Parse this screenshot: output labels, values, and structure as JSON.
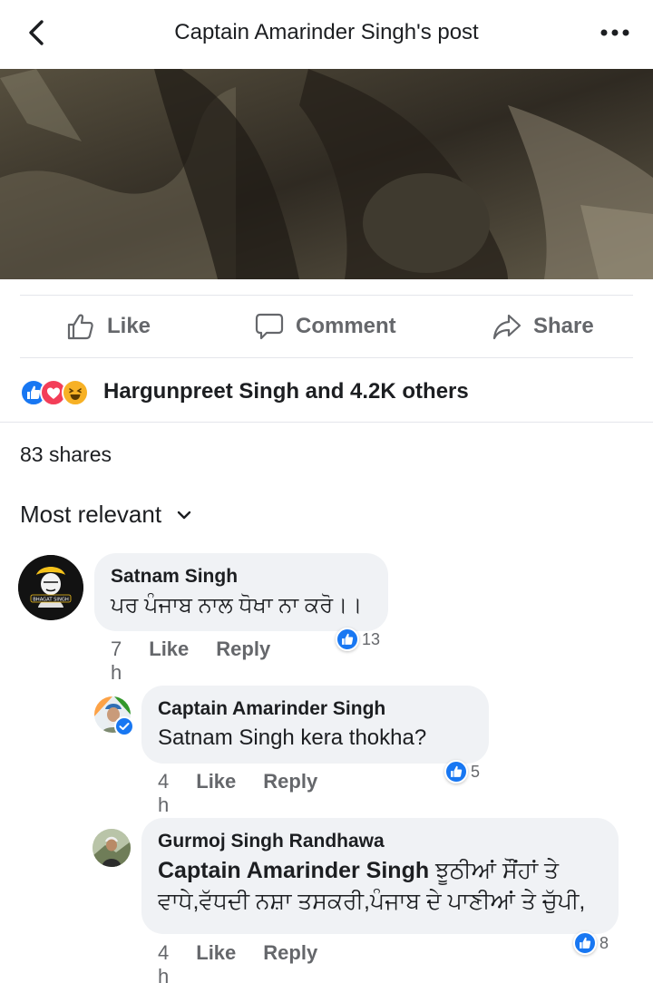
{
  "header": {
    "title": "Captain Amarinder Singh's post"
  },
  "actions": {
    "like": "Like",
    "comment": "Comment",
    "share": "Share"
  },
  "reactions": {
    "summary": "Hargunpreet Singh and 4.2K others",
    "icons": [
      "like-icon",
      "love-icon",
      "haha-icon"
    ]
  },
  "shares": "83 shares",
  "sort": {
    "label": "Most relevant"
  },
  "comments": [
    {
      "name": "Satnam Singh",
      "text": "ਪਰ ਪੰਜਾਬ ਨਾਲ ਧੋਖਾ ਨਾ ਕਰੋ।।",
      "time": "7 h",
      "like": "Like",
      "reply": "Reply",
      "likes": "13",
      "avatar_caption": "BHAGAT SINGH"
    },
    {
      "name": "Captain Amarinder Singh",
      "text": "Satnam Singh kera thokha?",
      "time": "4 h",
      "like": "Like",
      "reply": "Reply",
      "likes": "5"
    },
    {
      "name": "Gurmoj Singh Randhawa",
      "tag": "Captain Amarinder Singh",
      "text_line1": " ਝੂਠੀਆਂ ਸੌਂਹਾਂ ਤੇ",
      "text_line2": "ਵਾਧੇ,ਵੱਧਦੀ ਨਸ਼ਾ ਤਸਕਰੀ,ਪੰਜਾਬ ਦੇ ਪਾਣੀਆਂ ਤੇ ਚੁੱਪੀ,",
      "time": "4 h",
      "like": "Like",
      "reply": "Reply",
      "likes": "8"
    }
  ],
  "colors": {
    "accent": "#1877f2",
    "love": "#f33e58",
    "haha": "#f7b125",
    "bubble": "#f0f2f5",
    "meta": "#65676b"
  }
}
